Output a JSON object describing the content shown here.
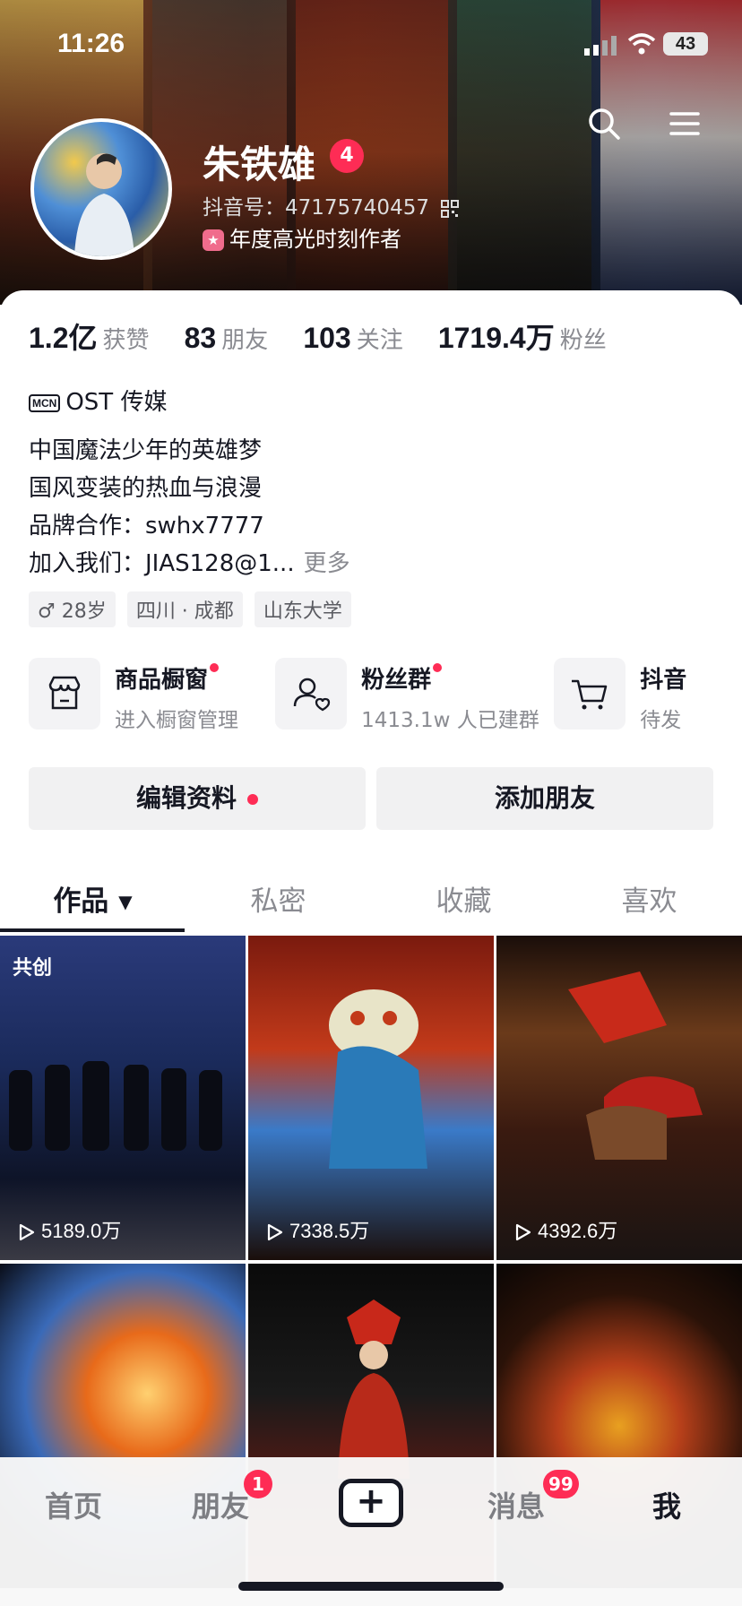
{
  "status_bar": {
    "time": "11:26",
    "battery": "43"
  },
  "profile": {
    "name": "朱铁雄",
    "level_badge": "4",
    "douyin_id": "抖音号：47175740457",
    "award": "年度高光时刻作者",
    "award_badge": "★"
  },
  "stats": [
    {
      "value": "1.2亿",
      "label": "获赞"
    },
    {
      "value": "83",
      "label": "朋友"
    },
    {
      "value": "103",
      "label": "关注"
    },
    {
      "value": "1719.4万",
      "label": "粉丝"
    }
  ],
  "mcn": {
    "tag": "MCN",
    "name": "OST 传媒"
  },
  "bio": {
    "line1": "中国魔法少年的英雄梦",
    "line2": "国风变装的热血与浪漫",
    "line3": "品牌合作：swhx7777",
    "line4": "加入我们：JIAS128@1...",
    "more": "更多"
  },
  "chips": [
    "♂ 28岁",
    "四川 · 成都",
    "山东大学"
  ],
  "services": [
    {
      "title": "商品橱窗",
      "sub": "进入橱窗管理"
    },
    {
      "title": "粉丝群",
      "sub": "1413.1w 人已建群"
    },
    {
      "title": "抖音",
      "sub": "待发"
    }
  ],
  "buttons": {
    "edit": "编辑资料",
    "add_friend": "添加朋友"
  },
  "tabs": [
    "作品 ▾",
    "私密",
    "收藏",
    "喜欢"
  ],
  "videos": [
    {
      "views": "5189.0万",
      "tag": "共创"
    },
    {
      "views": "7338.5万"
    },
    {
      "views": "4392.6万"
    },
    {
      "views": ""
    },
    {
      "views": ""
    },
    {
      "views": ""
    }
  ],
  "nav": {
    "home": "首页",
    "friends": "朋友",
    "friends_badge": "1",
    "create": "+",
    "messages": "消息",
    "messages_badge": "99",
    "me": "我"
  },
  "colors": {
    "accent": "#fe2c55",
    "text": "#161823",
    "muted": "#8a8b91"
  }
}
